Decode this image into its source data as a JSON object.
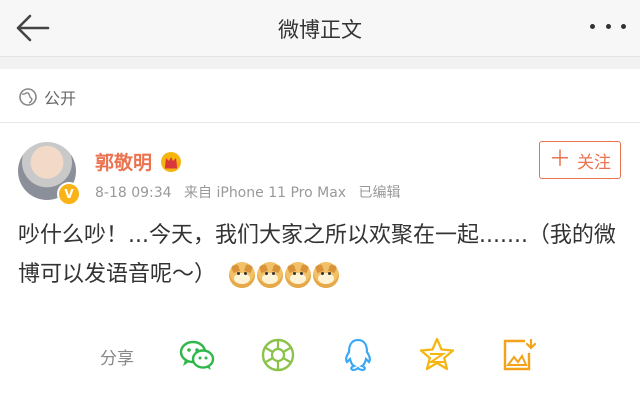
{
  "header": {
    "title": "微博正文"
  },
  "visibility": {
    "label": "公开"
  },
  "post": {
    "author": "郭敬明",
    "date": "8-18 09:34",
    "source": "来自 iPhone 11 Pro Max",
    "edited": "已编辑",
    "text": "吵什么吵！...今天，我们大家之所以欢聚在一起.......（我的微博可以发语音呢～）",
    "emoji_count": 4,
    "verified_badge": "V"
  },
  "follow": {
    "label": "关注",
    "plus": "＋"
  },
  "share": {
    "label": "分享",
    "targets": [
      "wechat-icon",
      "moments-icon",
      "qq-icon",
      "qzone-icon",
      "save-image-icon"
    ]
  },
  "colors": {
    "accent": "#eb7350",
    "wechat": "#2fb849",
    "moments": "#8bc34a",
    "qq": "#3aa8f3",
    "qzone": "#f5b613"
  }
}
